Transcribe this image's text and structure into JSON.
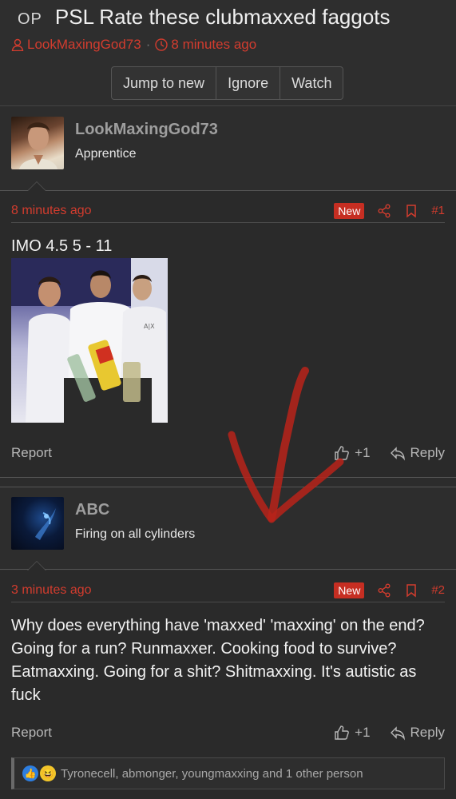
{
  "thread": {
    "op_badge": "OP",
    "title": "PSL Rate these clubmaxxed faggots",
    "author": "LookMaxingGod73",
    "time": "8 minutes ago",
    "buttons": [
      "Jump to new",
      "Ignore",
      "Watch"
    ]
  },
  "posts": [
    {
      "username": "LookMaxingGod73",
      "user_title": "Apprentice",
      "time": "8 minutes ago",
      "badge": "New",
      "number": "#1",
      "text": "IMO 4.5 5 - 11",
      "report": "Report",
      "like_count": "+1",
      "reply": "Reply",
      "image_caption": "A|X"
    },
    {
      "username": "ABC",
      "user_title": "Firing on all cylinders",
      "time": "3 minutes ago",
      "badge": "New",
      "number": "#2",
      "text": "Why does everything have 'maxxed' 'maxxing' on the end? Going for a run? Runmaxxer. Cooking food to survive? Eatmaxxing. Going for a shit? Shitmaxxing. It's autistic as fuck",
      "report": "Report",
      "like_count": "+1",
      "reply": "Reply",
      "reactions": "Tyronecell, abmonger, youngmaxxing and 1 other person"
    }
  ],
  "colors": {
    "accent_red": "#d23c2e",
    "background": "#2a2a2a",
    "annotation_arrow": "#b8231a"
  },
  "icons": [
    "user-icon",
    "clock-icon",
    "share-icon",
    "bookmark-icon",
    "thumbs-up-icon",
    "reply-icon",
    "like-reaction-icon",
    "laugh-reaction-icon"
  ]
}
